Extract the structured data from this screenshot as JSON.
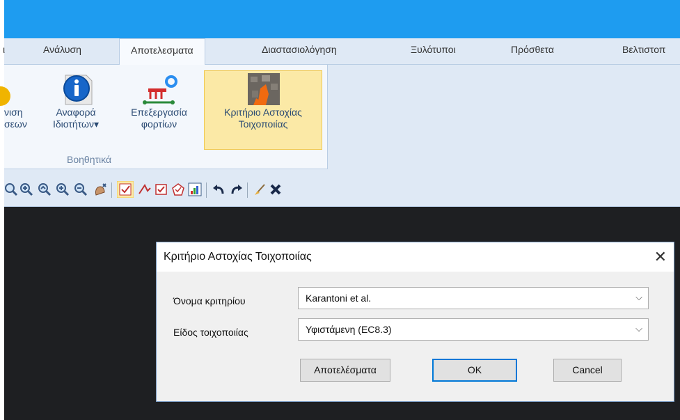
{
  "tabs": [
    {
      "label": "ι"
    },
    {
      "label": "Ανάλυση"
    },
    {
      "label": "Αποτελεσματα"
    },
    {
      "label": "Διαστασιολόγηση"
    },
    {
      "label": "Ξυλότυποι"
    },
    {
      "label": "Πρόσθετα"
    },
    {
      "label": "Βελτιστοπ"
    }
  ],
  "ribbon": {
    "partial_label_1": "νιση",
    "partial_label_2": "σεων",
    "report_label_1": "Αναφορά",
    "report_label_2": "Ιδιοτήτων",
    "dropdown_arrow": "▾",
    "load_label_1": "Επεξεργασία",
    "load_label_2": "φορτίων",
    "criterion_label_1": "Κριτήριο Αστοχίας",
    "criterion_label_2": "Τοιχοποιίας",
    "group_label": "Βοηθητικά"
  },
  "dialog": {
    "title": "Κριτήριο Αστοχίας Τοιχοποιίας",
    "close": "✕",
    "criterion_name_label": "Όνομα κριτηρίου",
    "criterion_name_value": "Karantoni et al.",
    "masonry_type_label": "Είδος τοιχοποιίας",
    "masonry_type_value": "Υφιστάμενη (EC8.3)",
    "combo_arrow": "⌵",
    "results_button": "Αποτελέσματα",
    "ok_button": "OK",
    "cancel_button": "Cancel"
  },
  "toolbar_icons": [
    "zoom-window-icon",
    "zoom-extents-icon",
    "zoom-previous-icon",
    "zoom-in-icon",
    "zoom-out-icon",
    "pan-icon",
    "select-icon",
    "polyline-icon",
    "checkbox-icon",
    "polygon-icon",
    "grid-icon",
    "undo-icon",
    "redo-icon",
    "brush-icon",
    "delete-icon"
  ],
  "colors": {
    "titlebar": "#1e9cf0",
    "accent": "#0078d7",
    "canvas": "#1e1f22"
  }
}
